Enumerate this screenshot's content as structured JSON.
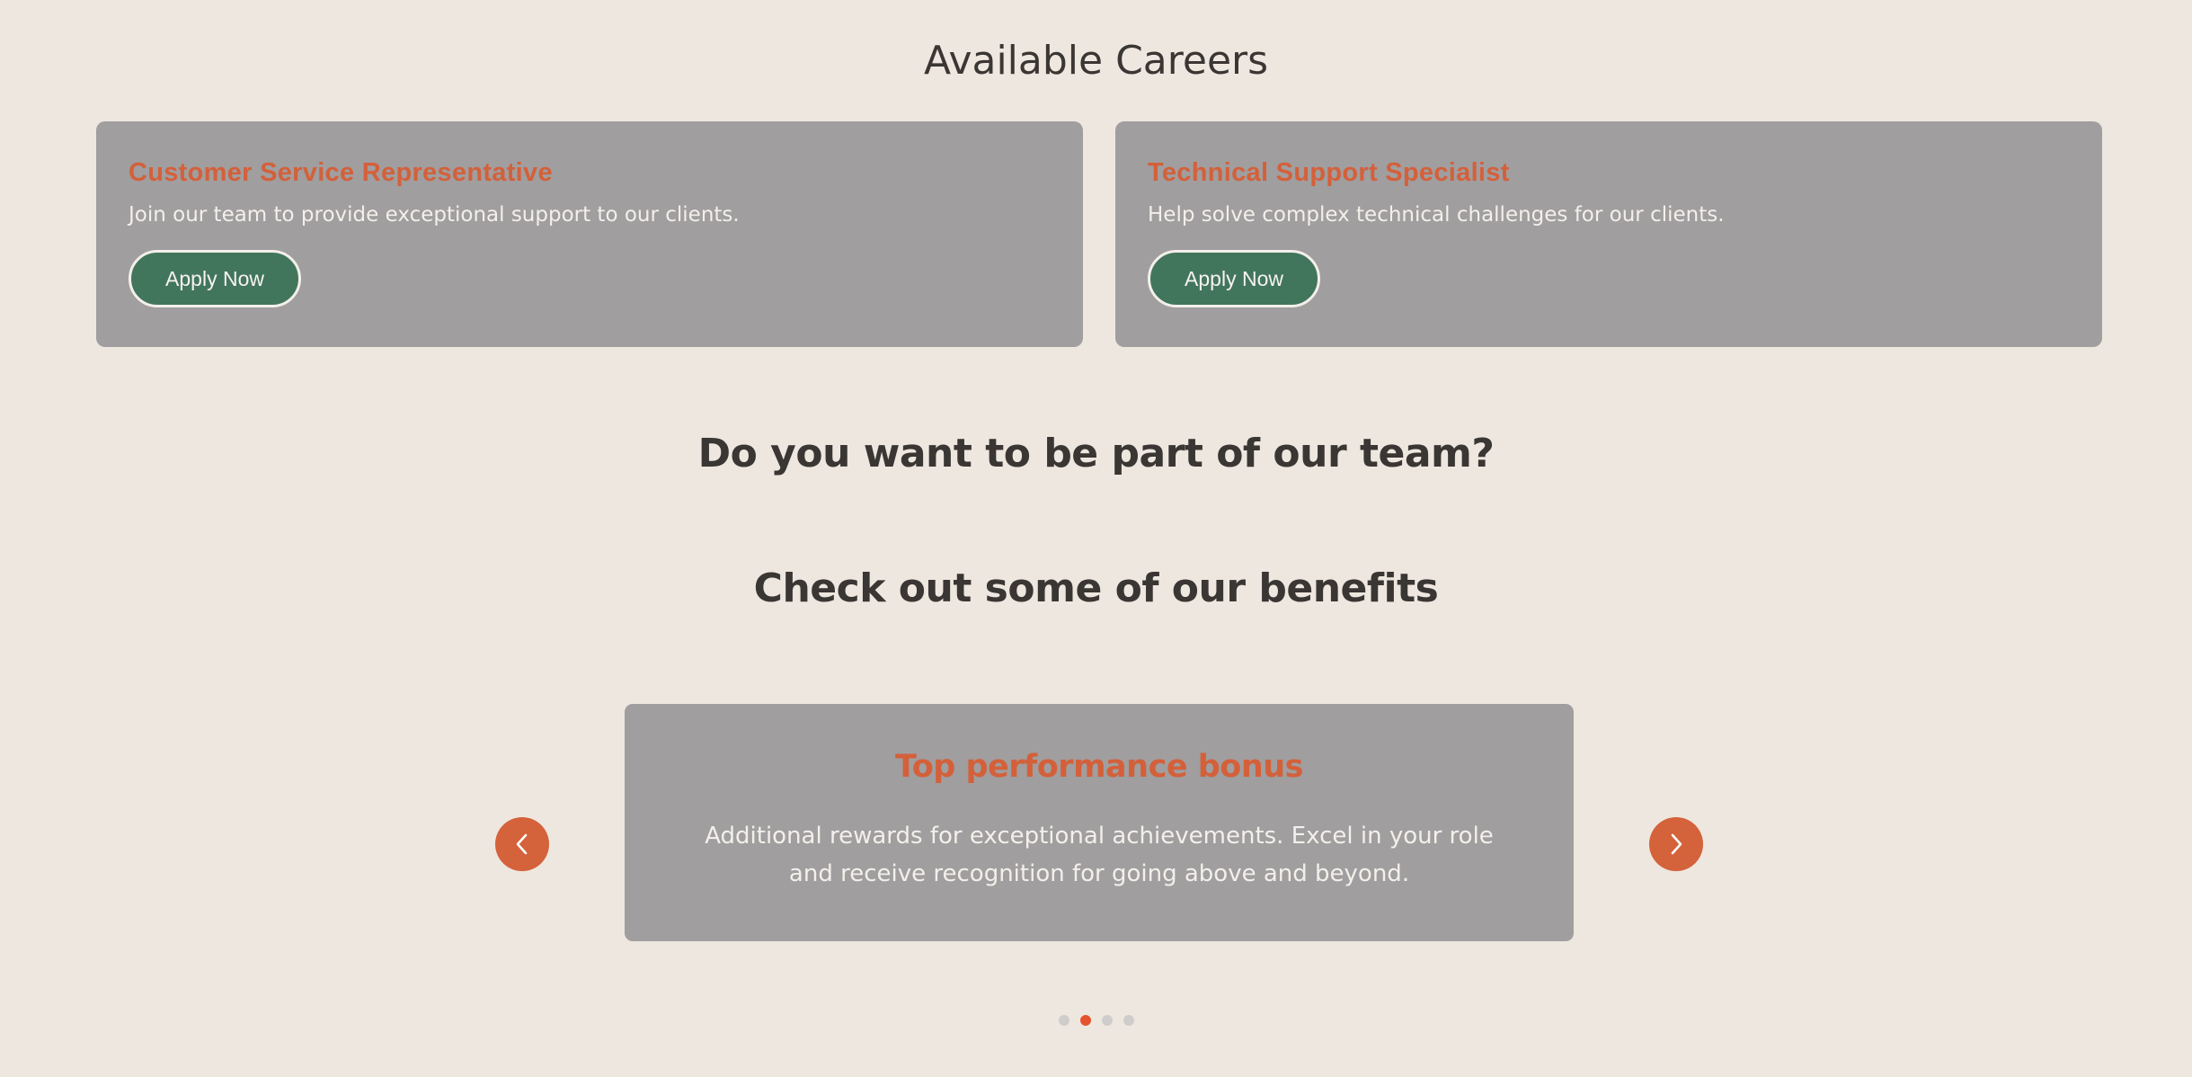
{
  "careers": {
    "title": "Available Careers",
    "jobs": [
      {
        "title": "Customer Service Representative",
        "description": "Join our team to provide exceptional support to our clients.",
        "button_label": "Apply Now"
      },
      {
        "title": "Technical Support Specialist",
        "description": "Help solve complex technical challenges for our clients.",
        "button_label": "Apply Now"
      }
    ]
  },
  "team": {
    "title": "Do you want to be part of our team?"
  },
  "benefits": {
    "title": "Check out some of our benefits",
    "current": {
      "title": "Top performance bonus",
      "description": "Additional rewards for exceptional achievements. Excel in your role and receive recognition for going above and beyond."
    },
    "prev_icon": "chevron-left-icon",
    "next_icon": "chevron-right-icon",
    "slide_count": 4,
    "active_slide": 2
  },
  "colors": {
    "background": "#EEE7E0",
    "card": "#A09E9F",
    "accent": "#D4603A",
    "button": "#42765C",
    "dot_active": "#E5532E",
    "dot_inactive": "#CFCCCB"
  }
}
